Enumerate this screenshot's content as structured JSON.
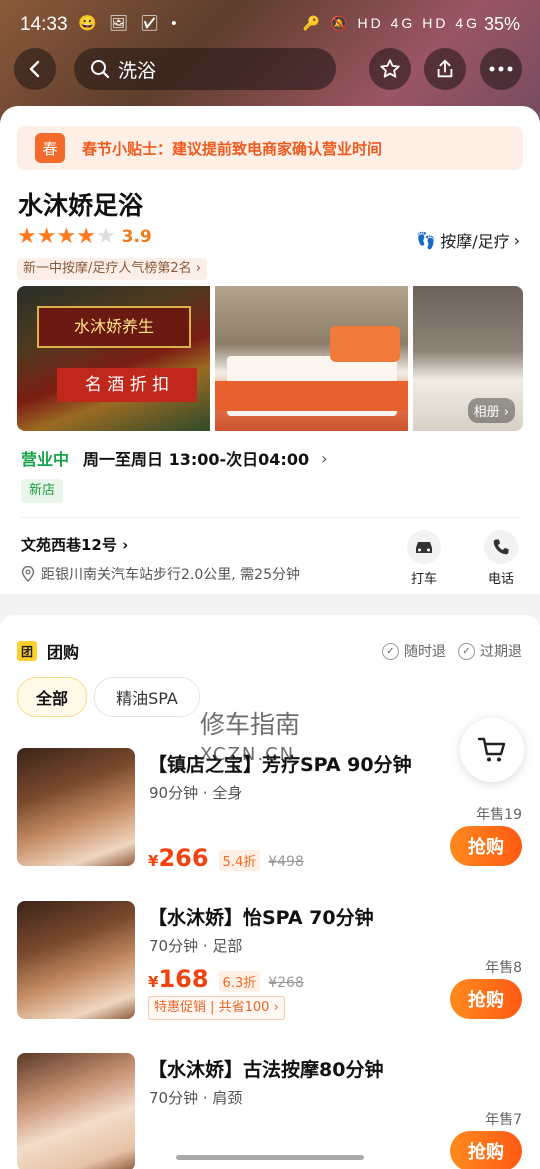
{
  "status_bar": {
    "time": "14:33",
    "left_icons": "😀 🖼 ☑ •",
    "right_icons": "🔑 🔕 HD 4G HD 4G",
    "battery": "35%"
  },
  "header": {
    "search_query": "洗浴"
  },
  "tip": {
    "badge": "春",
    "text": "春节小贴士：建议提前致电商家确认营业时间"
  },
  "shop": {
    "name": "水沐娇足浴",
    "rating": "3.9",
    "stars_full": 4,
    "category": "按摩/足疗",
    "rank": "新一中按摩/足疗人气榜第2名",
    "album_label": "相册",
    "photo1_sign": "水沐娇养生",
    "photo1_sign2": "名 酒 折 扣",
    "status": "营业中",
    "hours": "周一至周日 13:00-次日04:00",
    "new_tag": "新店",
    "address": "文苑西巷12号",
    "distance": "距银川南关汽车站步行2.0公里, 需25分钟",
    "action_taxi": "打车",
    "action_call": "电话"
  },
  "group": {
    "title": "团购",
    "badge": "团",
    "refund_anytime": "随时退",
    "refund_expired": "过期退",
    "tabs": [
      "全部",
      "精油SPA"
    ],
    "watermark_cn": "修车指南",
    "watermark_en": "XCZN.CN"
  },
  "deals": [
    {
      "name": "【镇店之宝】芳疗SPA 90分钟",
      "meta": "90分钟 · 全身",
      "sold": "年售19",
      "currency": "¥",
      "price": "266",
      "discount": "5.4折",
      "original": "¥498",
      "buy": "抢购"
    },
    {
      "name": "【水沐娇】怡SPA 70分钟",
      "meta": "70分钟 · 足部",
      "sold": "年售8",
      "currency": "¥",
      "price": "168",
      "discount": "6.3折",
      "original": "¥268",
      "promo": "特惠促销 | 共省100 ›",
      "buy": "抢购"
    },
    {
      "name": "【水沐娇】古法按摩80分钟",
      "meta": "70分钟 · 肩颈",
      "sold": "年售7",
      "buy": "抢购"
    }
  ]
}
